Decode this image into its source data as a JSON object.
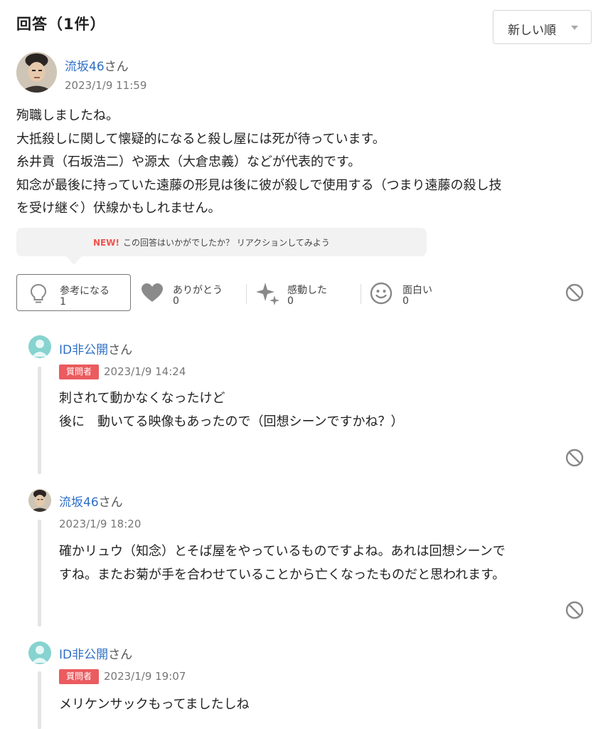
{
  "header": {
    "title": "回答（1件）",
    "sort_label": "新しい順"
  },
  "answer": {
    "user_name": "流坂46",
    "honorific": "さん",
    "timestamp": "2023/1/9 11:59",
    "body_lines": [
      "殉職しましたね。",
      "大抵殺しに関して懐疑的になると殺し屋には死が待っています。",
      "糸井貢（石坂浩二）や源太（大倉忠義）などが代表的です。",
      "知念が最後に持っていた遠藤の形見は後に彼が殺しで使用する（つまり遠藤の殺し技",
      "を受け継ぐ）伏線かもしれません。"
    ]
  },
  "reaction_prompt": {
    "new_label": "NEW!",
    "text": "この回答はいかがでしたか？ リアクションしてみよう"
  },
  "reactions": [
    {
      "label": "参考になる",
      "count": "1",
      "icon": "lightbulb-icon"
    },
    {
      "label": "ありがとう",
      "count": "0",
      "icon": "heart-icon"
    },
    {
      "label": "感動した",
      "count": "0",
      "icon": "sparkle-icon"
    },
    {
      "label": "面白い",
      "count": "0",
      "icon": "smile-icon"
    }
  ],
  "replies": [
    {
      "user_name": "ID非公開",
      "honorific": "さん",
      "badge": "質問者",
      "timestamp": "2023/1/9 14:24",
      "body_lines": [
        "刺されて動かなくなったけど",
        "後に　動いてる映像もあったので（回想シーンですかね？）"
      ]
    },
    {
      "user_name": "流坂46",
      "honorific": "さん",
      "timestamp": "2023/1/9 18:20",
      "body_lines": [
        "確かリュウ（知念）とそば屋をやっているものですよね。あれは回想シーンで",
        "すね。またお菊が手を合わせていることから亡くなったものだと思われます。"
      ]
    },
    {
      "user_name": "ID非公開",
      "honorific": "さん",
      "badge": "質問者",
      "timestamp": "2023/1/9 19:07",
      "body_lines": [
        "メリケンサックもってましたしね"
      ]
    }
  ],
  "colors": {
    "link": "#2e6fc7",
    "badge": "#eb5b5f",
    "anon_avatar": "#86d3cf",
    "new_label": "#f0534f"
  }
}
